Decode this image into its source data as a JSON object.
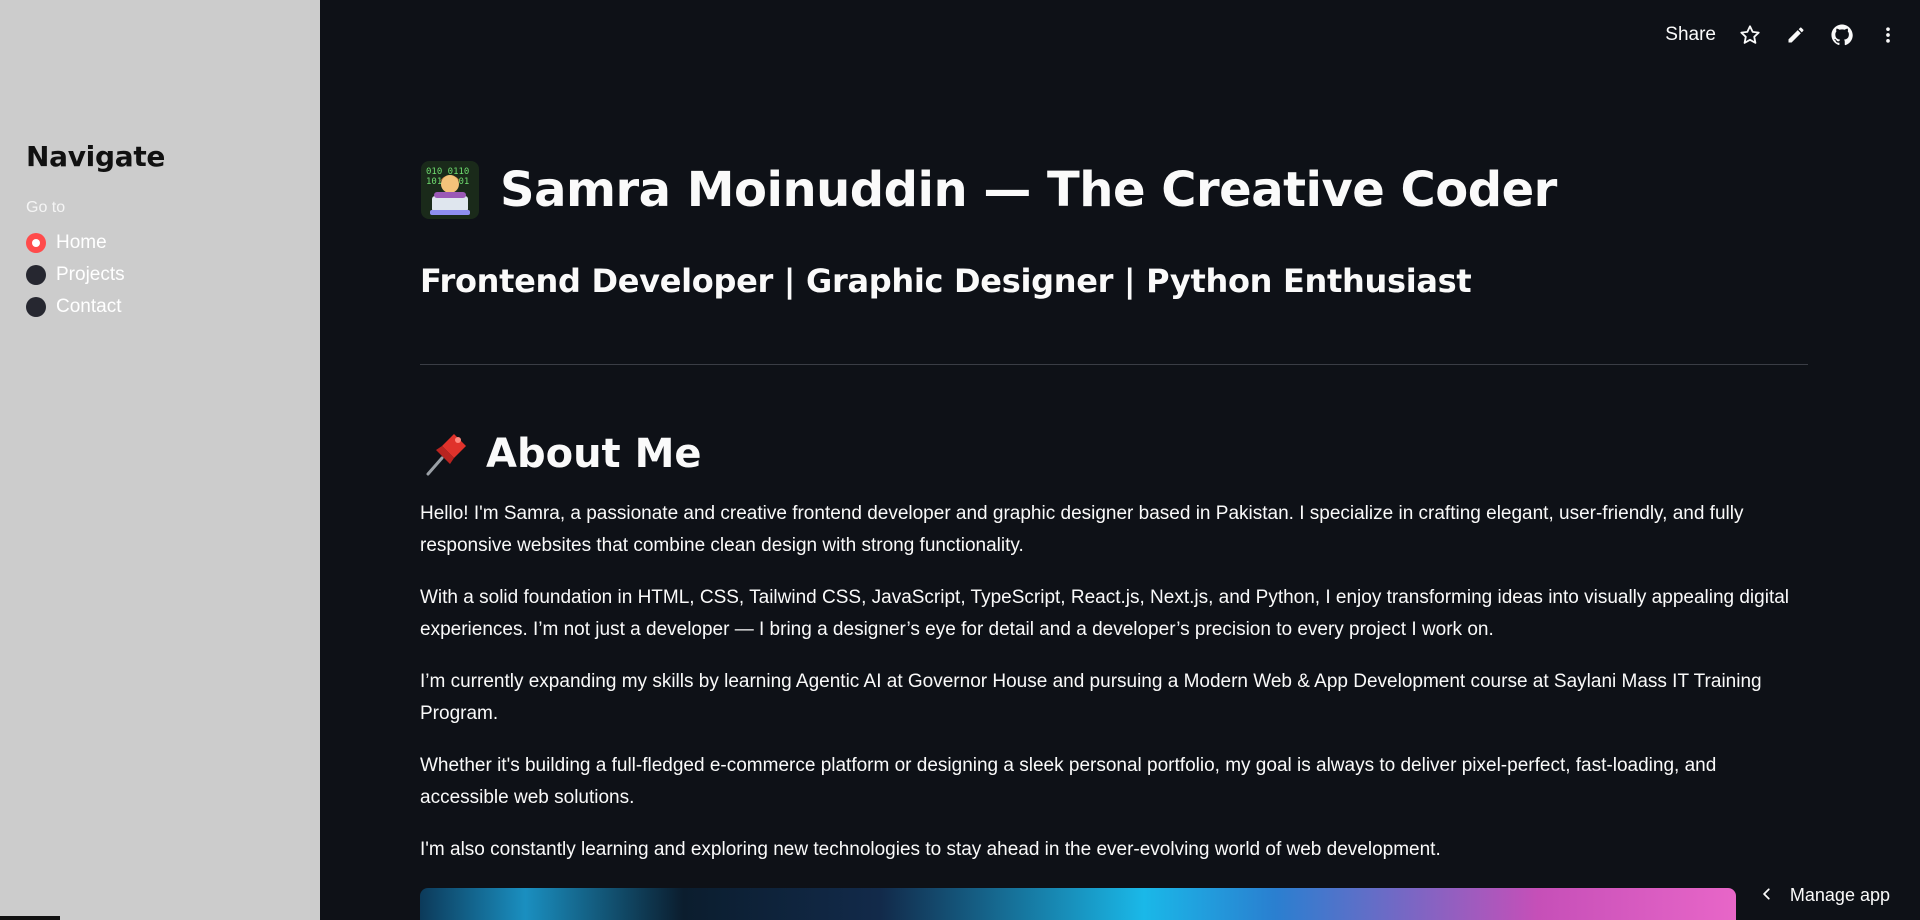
{
  "sidebar": {
    "title": "Navigate",
    "radio_label": "Go to",
    "options": [
      {
        "label": "Home",
        "selected": true
      },
      {
        "label": "Projects",
        "selected": false
      },
      {
        "label": "Contact",
        "selected": false
      }
    ]
  },
  "toolbar": {
    "share_label": "Share",
    "icons": [
      "star-icon",
      "pencil-icon",
      "github-icon",
      "more-vertical-icon"
    ]
  },
  "main": {
    "title": "Samra Moinuddin — The Creative Coder",
    "title_emoji": "technologist-emoji",
    "subtitle": "Frontend Developer | Graphic Designer | Python Enthusiast",
    "about_heading": "About Me",
    "about_emoji": "pushpin-emoji",
    "paragraphs": [
      "Hello! I'm Samra, a passionate and creative frontend developer and graphic designer based in Pakistan. I specialize in crafting elegant, user-friendly, and fully responsive websites that combine clean design with strong functionality.",
      "With a solid foundation in HTML, CSS, Tailwind CSS, JavaScript, TypeScript, React.js, Next.js, and Python, I enjoy transforming ideas into visually appealing digital experiences. I’m not just a developer — I bring a designer’s eye for detail and a developer’s precision to every project I work on.",
      "I’m currently expanding my skills by learning Agentic AI at Governor House and pursuing a Modern Web & App Development course at Saylani Mass IT Training Program.",
      "Whether it's building a full-fledged e-commerce platform or designing a sleek personal portfolio, my goal is always to deliver pixel-perfect, fast-loading, and accessible web solutions.",
      "I'm also constantly learning and exploring new technologies to stay ahead in the ever-evolving world of web development."
    ]
  },
  "footer": {
    "manage_app_label": "Manage app"
  },
  "colors": {
    "accent": "#ff4b4b",
    "background": "#0e1117",
    "sidebar_bg": "#cccccc"
  }
}
